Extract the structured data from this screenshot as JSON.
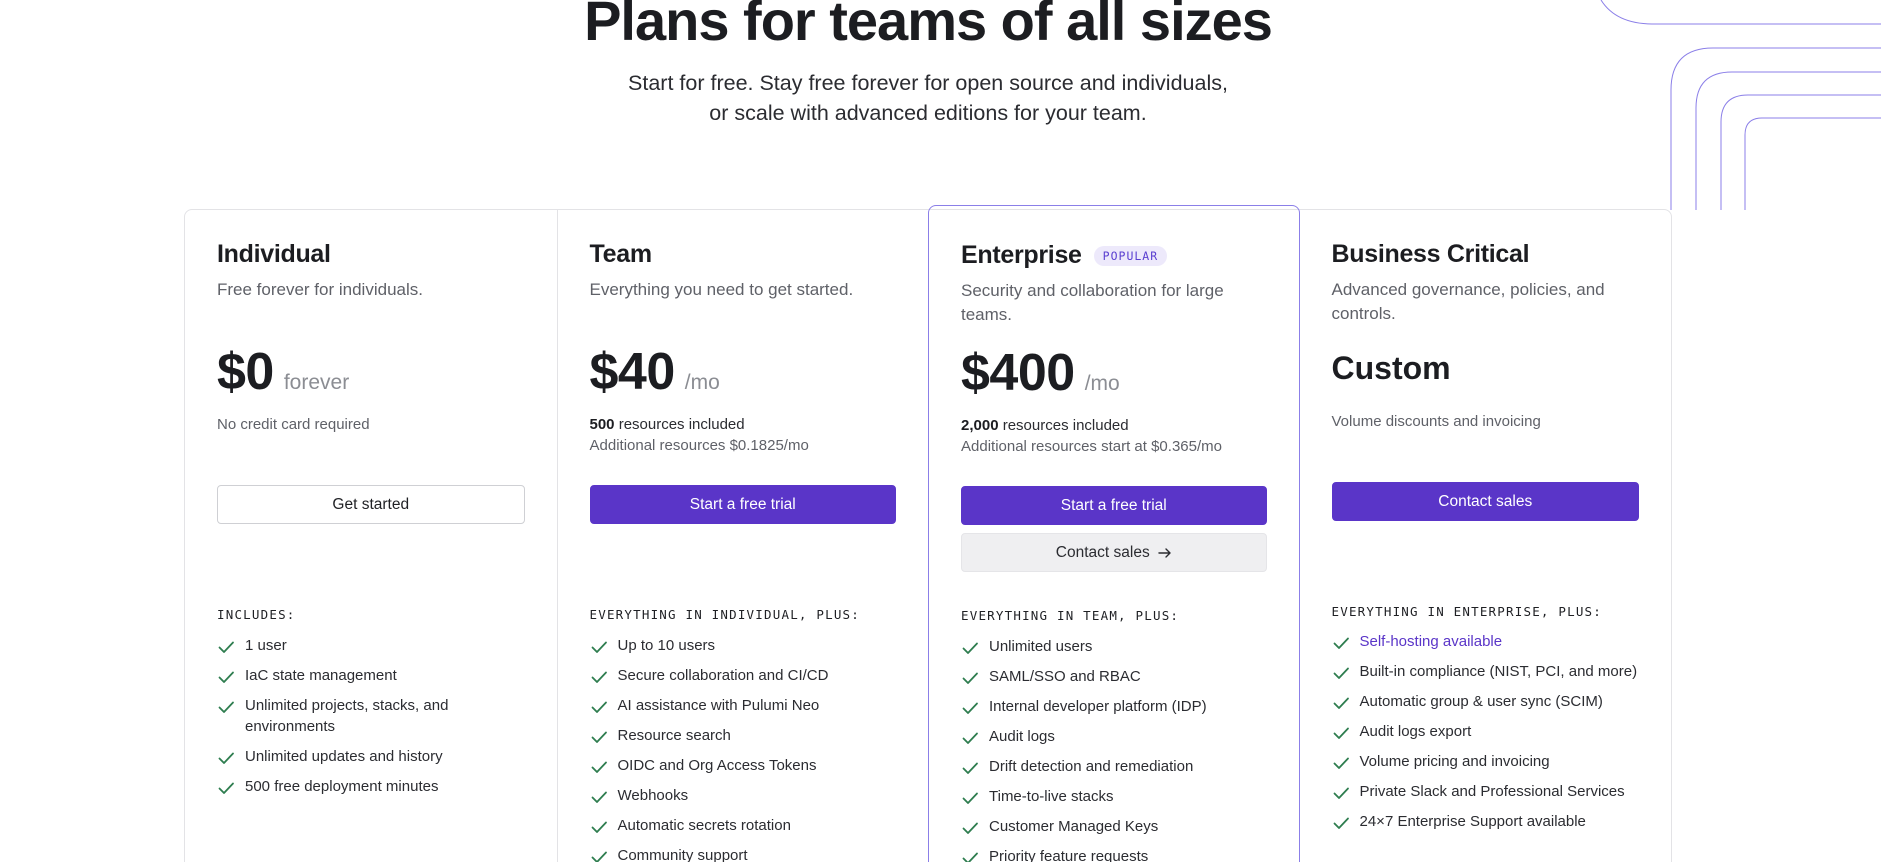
{
  "hero": {
    "title": "Plans for teams of all sizes",
    "subtitle": "Start for free. Stay free forever for open source and individuals, or scale with advanced editions for your team."
  },
  "colors": {
    "accent": "#5a35c8",
    "check": "#2e7d4f",
    "badge_bg": "#ede9fb"
  },
  "plans": [
    {
      "name": "Individual",
      "description": "Free forever for individuals.",
      "price": "$0",
      "price_unit": "forever",
      "note_line1": "No credit card required",
      "primary_button": "Get started",
      "includes_title": "INCLUDES:",
      "features": [
        "1 user",
        "IaC state management",
        "Unlimited projects, stacks, and environments",
        "Unlimited updates and history",
        "500 free deployment minutes"
      ]
    },
    {
      "name": "Team",
      "description": "Everything you need to get started.",
      "price": "$40",
      "price_unit": "/mo",
      "note_strong": "500",
      "note_rest": " resources included",
      "note_line2": "Additional resources $0.1825/mo",
      "primary_button": "Start a free trial",
      "includes_title": "EVERYTHING IN INDIVIDUAL, PLUS:",
      "features": [
        "Up to 10 users",
        "Secure collaboration and CI/CD",
        "AI assistance with Pulumi Neo",
        "Resource search",
        "OIDC and Org Access Tokens",
        "Webhooks",
        "Automatic secrets rotation",
        "Community support"
      ]
    },
    {
      "name": "Enterprise",
      "badge": "POPULAR",
      "description": "Security and collaboration for large teams.",
      "price": "$400",
      "price_unit": "/mo",
      "note_strong": "2,000",
      "note_rest": " resources included",
      "note_line2": "Additional resources start at $0.365/mo",
      "primary_button": "Start a free trial",
      "secondary_button": "Contact sales",
      "secondary_icon": "arrow-right-icon",
      "includes_title": "EVERYTHING IN TEAM, PLUS:",
      "features": [
        "Unlimited users",
        "SAML/SSO and RBAC",
        "Internal developer platform (IDP)",
        "Audit logs",
        "Drift detection and remediation",
        "Time-to-live stacks",
        "Customer Managed Keys",
        "Priority feature requests"
      ]
    },
    {
      "name": "Business Critical",
      "description": "Advanced governance, policies, and controls.",
      "price": "Custom",
      "note_line1": "Volume discounts and invoicing",
      "primary_button": "Contact sales",
      "includes_title": "EVERYTHING IN ENTERPRISE, PLUS:",
      "features": [
        "Self-hosting available",
        "Built-in compliance (NIST, PCI, and more)",
        "Automatic group & user sync (SCIM)",
        "Audit logs export",
        "Volume pricing and invoicing",
        "Private Slack and Professional Services",
        "24×7 Enterprise Support available"
      ]
    }
  ]
}
